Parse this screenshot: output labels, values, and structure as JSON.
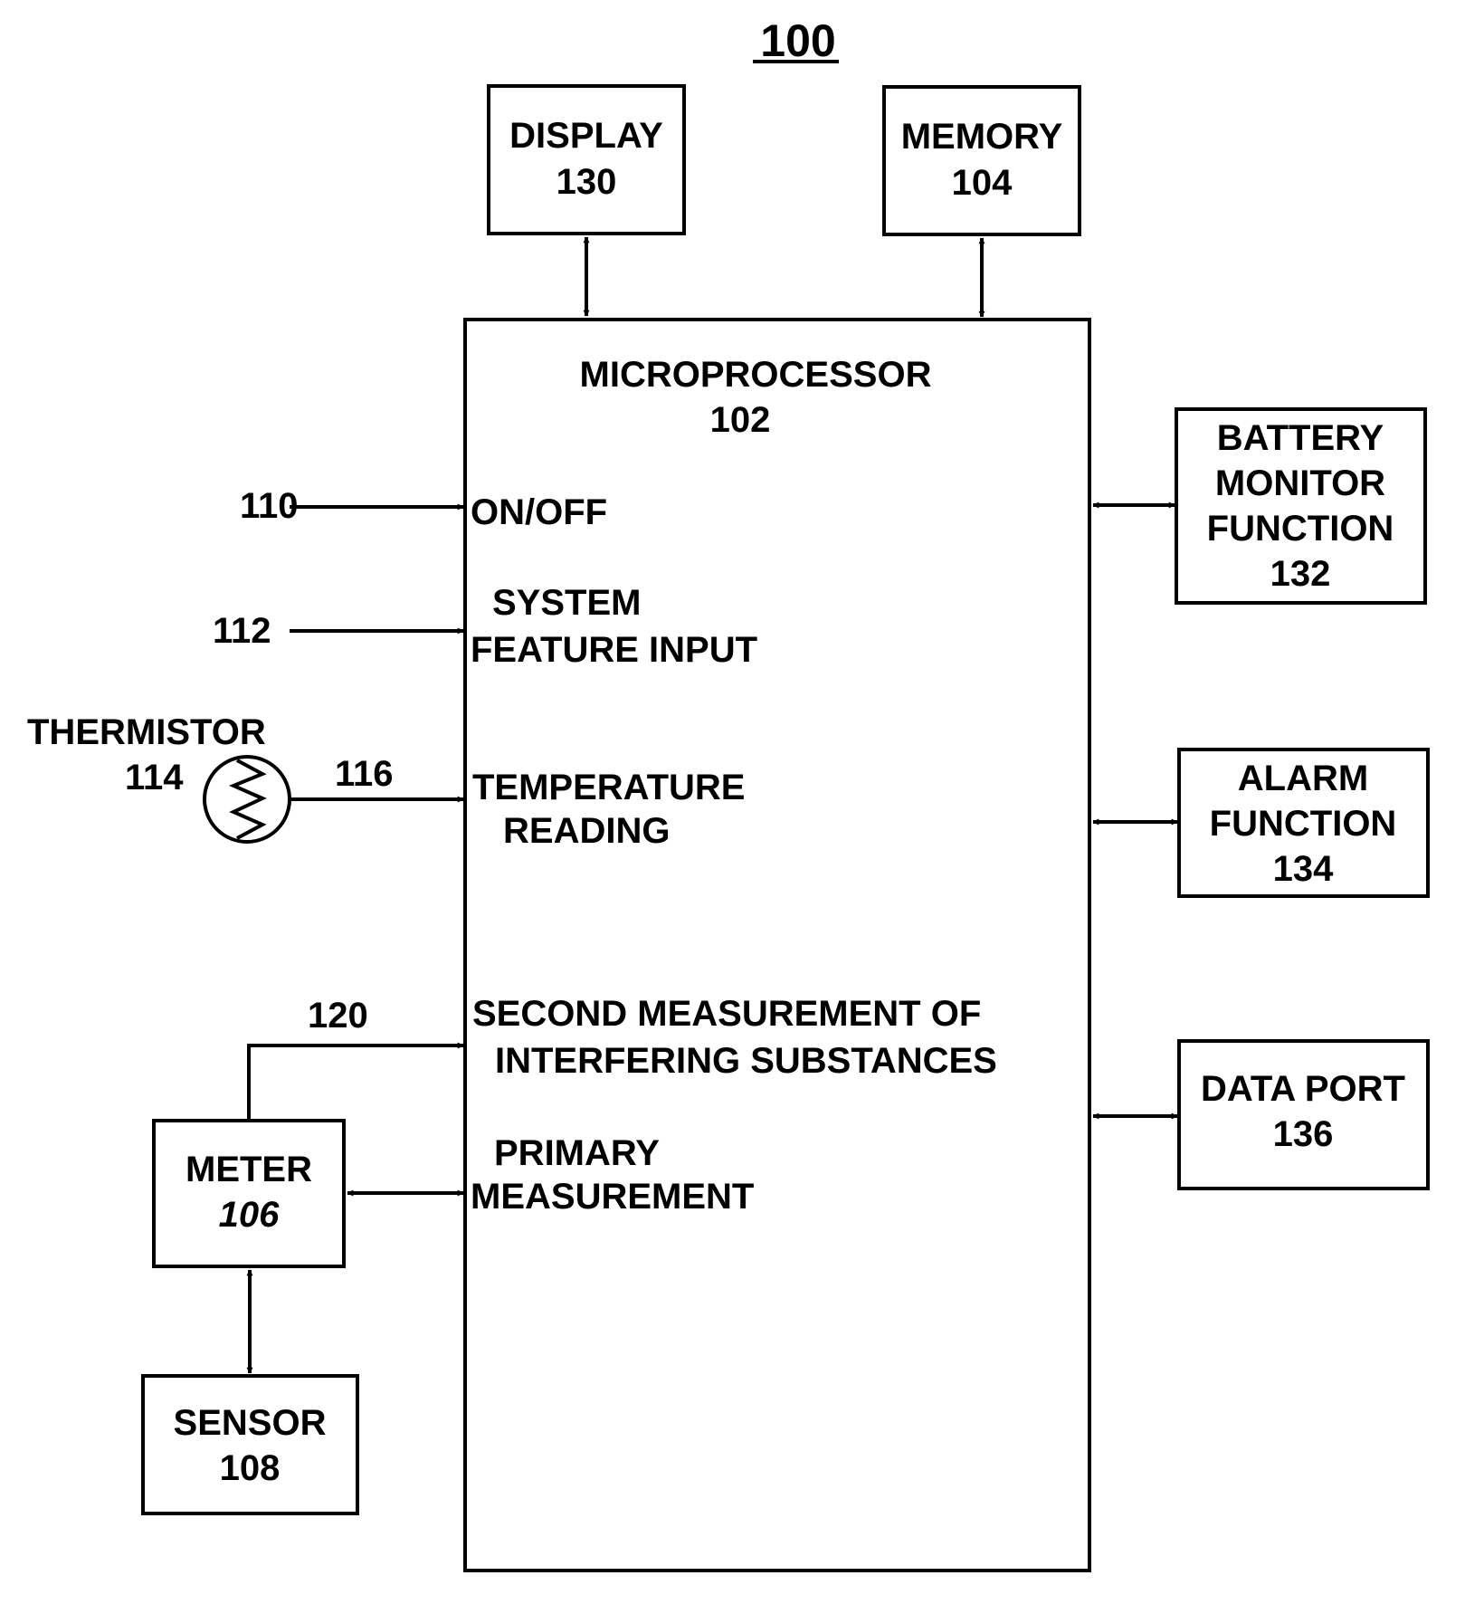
{
  "figure": {
    "ref": "100"
  },
  "blocks": {
    "display": {
      "line1": "DISPLAY",
      "ref": "130"
    },
    "memory": {
      "line1": "MEMORY",
      "ref": "104"
    },
    "microprocessor": {
      "title": "MICROPROCESSOR",
      "ref": "102",
      "inputs": {
        "on_off": "ON/OFF",
        "system_feature_line1": "SYSTEM",
        "system_feature_line2": "FEATURE INPUT",
        "temperature_line1": "TEMPERATURE",
        "temperature_line2": "READING",
        "second_measurement_line1": "SECOND MEASUREMENT OF",
        "second_measurement_line2": "INTERFERING SUBSTANCES",
        "primary_line1": "PRIMARY",
        "primary_line2": "MEASUREMENT"
      }
    },
    "battery": {
      "line1": "BATTERY",
      "line2": "MONITOR",
      "line3": "FUNCTION",
      "ref": "132"
    },
    "alarm": {
      "line1": "ALARM",
      "line2": "FUNCTION",
      "ref": "134"
    },
    "data_port": {
      "line1": "DATA PORT",
      "ref": "136"
    },
    "meter": {
      "line1": "METER",
      "ref": "106"
    },
    "sensor": {
      "line1": "SENSOR",
      "ref": "108"
    },
    "thermistor": {
      "label": "THERMISTOR",
      "ref": "114"
    }
  },
  "signals": {
    "on_off_ref": "110",
    "system_feature_ref": "112",
    "temperature_ref": "116",
    "second_measurement_ref": "120"
  }
}
